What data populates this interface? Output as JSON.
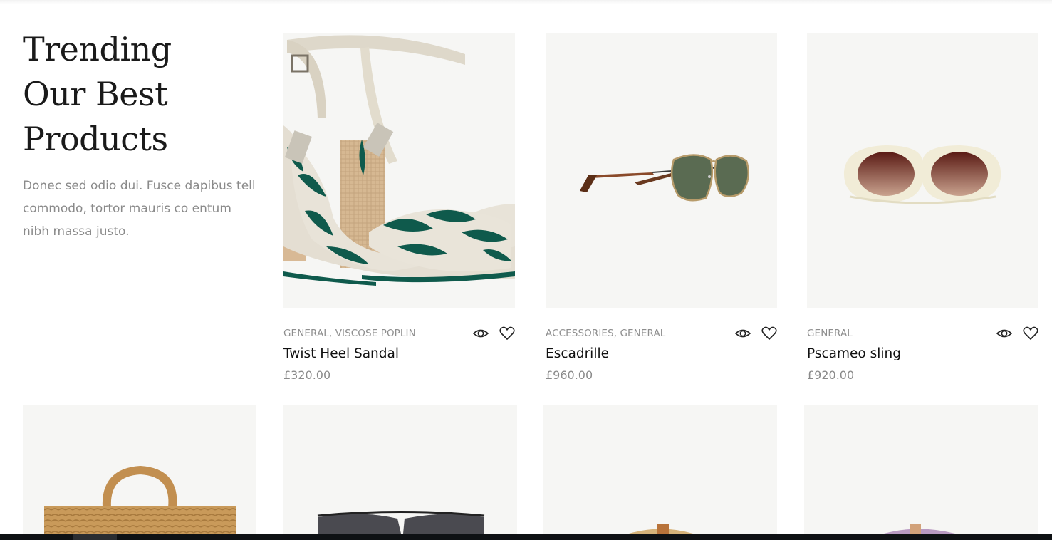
{
  "section": {
    "title_lines": [
      "Trending",
      "Our Best",
      "Products"
    ],
    "description": "Donec sed odio dui. Fusce dapibus tell commodo, tortor mauris co entum nibh massa justo."
  },
  "products": [
    {
      "categories": "GENERAL, VISCOSE POPLIN",
      "name": "Twist Heel Sandal",
      "price": "£320.00",
      "image_icon": "sandal-image",
      "actions": [
        "quick-view-icon",
        "wishlist-heart-icon"
      ]
    },
    {
      "categories": "ACCESSORIES, GENERAL",
      "name": "Escadrille",
      "price": "£960.00",
      "image_icon": "sunglasses-image",
      "actions": [
        "quick-view-icon",
        "wishlist-heart-icon"
      ]
    },
    {
      "categories": "GENERAL",
      "name": "Pscameo sling",
      "price": "£920.00",
      "image_icon": "round-sunglasses-image",
      "actions": [
        "quick-view-icon",
        "wishlist-heart-icon"
      ]
    }
  ],
  "second_row": [
    {
      "image_icon": "woven-basket-bag-image"
    },
    {
      "image_icon": "aviator-sunglasses-image"
    },
    {
      "image_icon": "rattan-bag-image"
    },
    {
      "image_icon": "lilac-rattan-bag-image"
    }
  ],
  "colors": {
    "thumb_bg": "#f6f6f4",
    "text_primary": "#111111",
    "text_muted": "#8a8a8a",
    "sandal_green": "#0f5a4c",
    "lens_green": "#5a6b52",
    "lens_brown": "#6b2a22"
  }
}
